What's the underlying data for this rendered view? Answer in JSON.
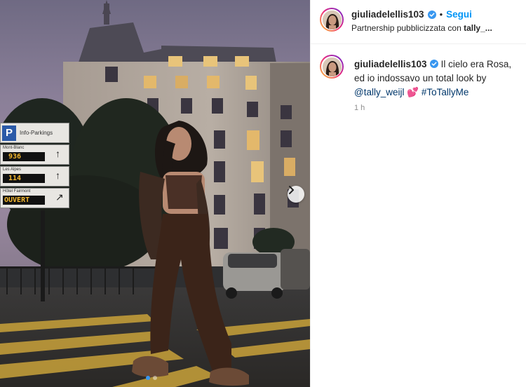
{
  "media": {
    "signs": {
      "parking_label": "Info-Parkings",
      "p_letter": "P",
      "rows": [
        {
          "name": "Mont-Blanc",
          "value": "936"
        },
        {
          "name": "Les Alpes",
          "value": "114"
        },
        {
          "name": "Hôtel Fairmont",
          "value": "OUVERT"
        }
      ]
    },
    "carousel": {
      "count": 2,
      "active_index": 0
    },
    "next_icon": "chevron-right-icon"
  },
  "header": {
    "username": "giulia​delellis103",
    "verified_icon": "verified-badge-icon",
    "separator": "•",
    "follow_label": "Segui",
    "partnership_prefix": "Partnership pubblicizzata con ",
    "partner_name": "tally_..."
  },
  "caption": {
    "username": "giuliadelellis103",
    "text": "Il cielo era Rosa, ed io indossavo un total look by",
    "mention": "@tally_weijl",
    "emoji": "💕",
    "hashtag": "#ToTallyMe",
    "time": "1 h"
  },
  "colors": {
    "accent": "#0095f6",
    "verified": "#3897f0",
    "link": "#00376b"
  }
}
